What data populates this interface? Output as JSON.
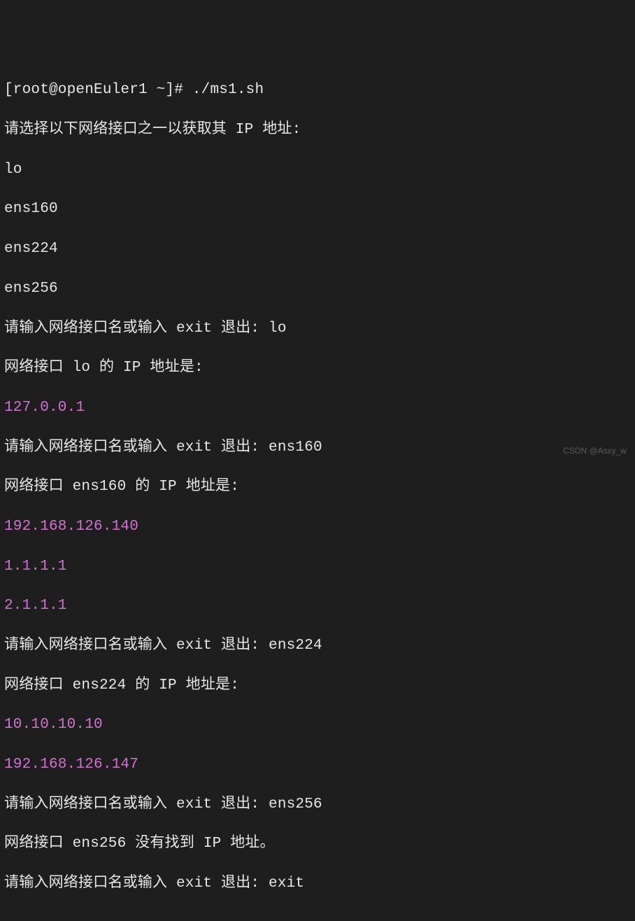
{
  "terminal": {
    "prompt_line": "[root@openEuler1 ~]# ./ms1.sh",
    "select_prompt": "请选择以下网络接口之一以获取其 IP 地址:",
    "iface1": "lo",
    "iface2": "ens160",
    "iface3": "ens224",
    "iface4": "ens256",
    "input_lo": "请输入网络接口名或输入 exit 退出: lo",
    "result_lo": "网络接口 lo 的 IP 地址是:",
    "ip_lo_1": "127.0.0.1",
    "input_ens160": "请输入网络接口名或输入 exit 退出: ens160",
    "result_ens160": "网络接口 ens160 的 IP 地址是:",
    "ip_ens160_1": "192.168.126.140",
    "ip_ens160_2": "1.1.1.1",
    "ip_ens160_3": "2.1.1.1",
    "input_ens224": "请输入网络接口名或输入 exit 退出: ens224",
    "result_ens224": "网络接口 ens224 的 IP 地址是:",
    "ip_ens224_1": "10.10.10.10",
    "ip_ens224_2": "192.168.126.147",
    "input_ens256": "请输入网络接口名或输入 exit 退出: ens256",
    "result_ens256": "网络接口 ens256 没有找到 IP 地址。",
    "input_exit": "请输入网络接口名或输入 exit 退出: exit",
    "watermark": "CSDN @Asxy_w"
  }
}
